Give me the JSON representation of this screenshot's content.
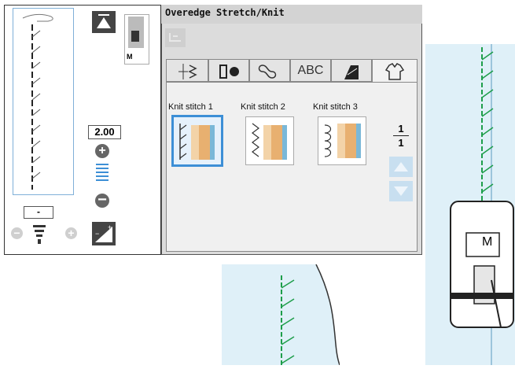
{
  "title": "Overedge Stretch/Knit",
  "width_value": "2.00",
  "length_value": "-",
  "foot_letter": "M",
  "presser_foot_letter": "M",
  "tabs": [
    {
      "icon": "utility-stitch-icon",
      "label": ""
    },
    {
      "icon": "buttonhole-icon",
      "label": ""
    },
    {
      "icon": "decorative-stitch-icon",
      "label": ""
    },
    {
      "icon": "letters-icon",
      "label": "ABC"
    },
    {
      "icon": "quilt-stitch-icon",
      "label": ""
    },
    {
      "icon": "garment-icon",
      "label": ""
    }
  ],
  "stitches": [
    {
      "label": "Knit stitch 1",
      "selected": true
    },
    {
      "label": "Knit stitch 2",
      "selected": false
    },
    {
      "label": "Knit stitch 3",
      "selected": false
    }
  ],
  "page": {
    "current": "1",
    "total": "1"
  },
  "colors": {
    "accent": "#3d8fd6",
    "stitch_green": "#1e9e4a",
    "fabric_blue": "#dff0f8"
  }
}
